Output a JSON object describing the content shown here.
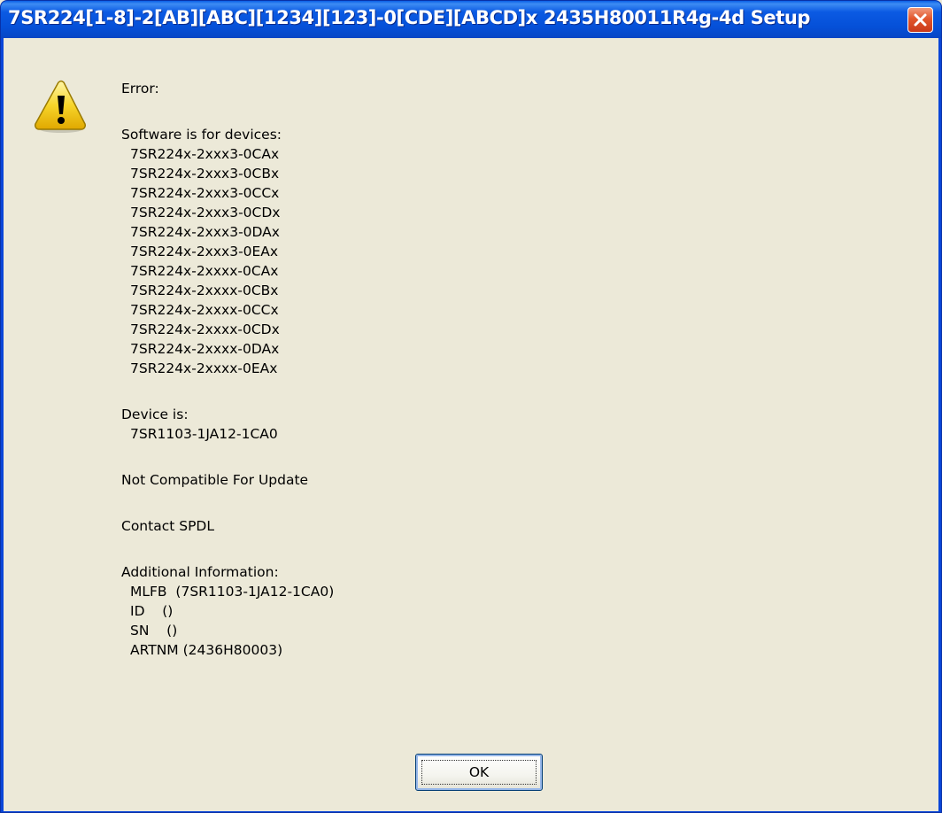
{
  "window": {
    "title": "7SR224[1-8]-2[AB][ABC][1234][123]-0[CDE][ABCD]x 2435H80011R4g-4d Setup",
    "close_icon": "close-icon"
  },
  "message": {
    "icon": "warning-icon",
    "error_label": "Error:",
    "software_header": "Software is for devices:",
    "devices": [
      "7SR224x-2xxx3-0CAx",
      "7SR224x-2xxx3-0CBx",
      "7SR224x-2xxx3-0CCx",
      "7SR224x-2xxx3-0CDx",
      "7SR224x-2xxx3-0DAx",
      "7SR224x-2xxx3-0EAx",
      "7SR224x-2xxxx-0CAx",
      "7SR224x-2xxxx-0CBx",
      "7SR224x-2xxxx-0CCx",
      "7SR224x-2xxxx-0CDx",
      "7SR224x-2xxxx-0DAx",
      "7SR224x-2xxxx-0EAx"
    ],
    "device_header": "Device is:",
    "device_value": "7SR1103-1JA12-1CA0",
    "status": "Not Compatible For Update",
    "contact": "Contact SPDL",
    "additional_header": "Additional Information:",
    "additional": [
      "MLFB  (7SR1103-1JA12-1CA0)",
      "ID    ()",
      "SN    ()",
      "ARTNM (2436H80003)"
    ]
  },
  "buttons": {
    "ok_label": "OK"
  }
}
